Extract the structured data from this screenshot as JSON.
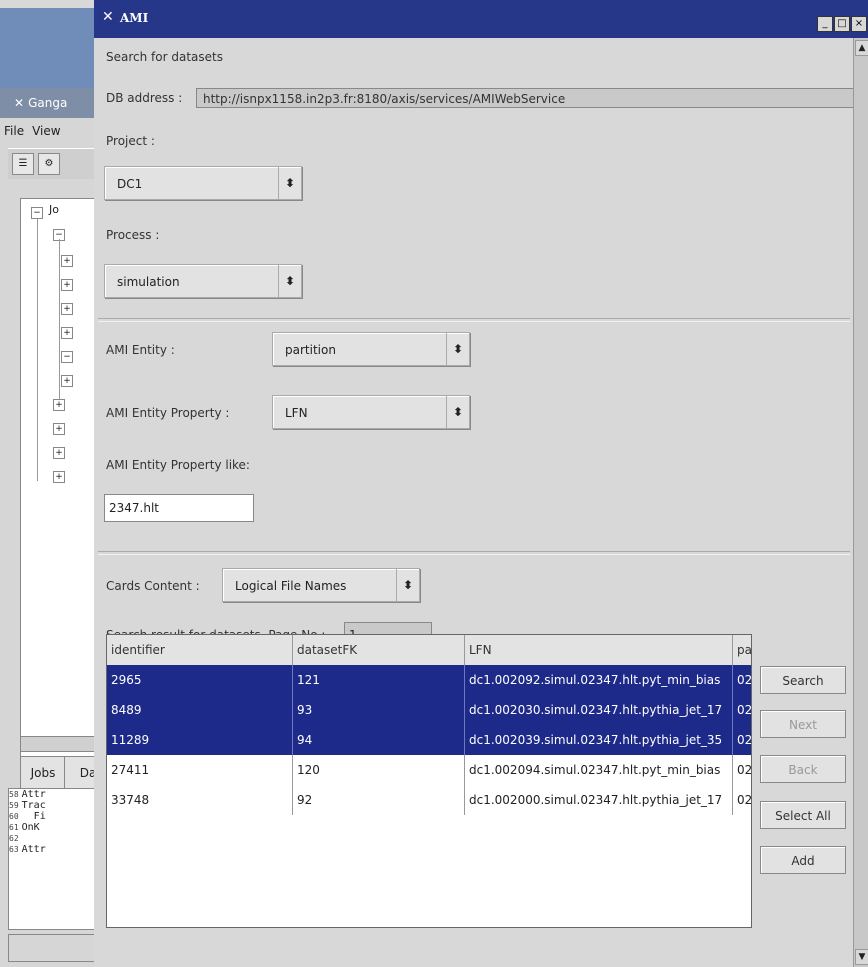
{
  "background_window": {
    "title": "Ganga",
    "menu": [
      "File",
      "View"
    ],
    "tree_label": "Jo",
    "tabs": [
      "Jobs",
      "Da"
    ],
    "console_lines": [
      {
        "num": "58",
        "text": "Attr"
      },
      {
        "num": "59",
        "text": "Trac"
      },
      {
        "num": "60",
        "text": "  Fi"
      },
      {
        "num": "61",
        "text": "OnK"
      },
      {
        "num": "62",
        "text": ""
      },
      {
        "num": "63",
        "text": "Attr"
      }
    ]
  },
  "dialog": {
    "title": "AMI",
    "window_buttons": [
      "_",
      "□",
      "×"
    ],
    "heading": "Search for datasets",
    "db_address_label": "DB address :",
    "db_address_value": "http://isnpx1158.in2p3.fr:8180/axis/services/AMIWebService",
    "project_label": "Project :",
    "project_value": "DC1",
    "process_label": "Process :",
    "process_value": "simulation",
    "entity_label": "AMI Entity :",
    "entity_value": "partition",
    "entity_property_label": "AMI Entity Property :",
    "entity_property_value": "LFN",
    "property_like_label": "AMI Entity Property like:",
    "property_like_value": "2347.hlt",
    "cards_content_label": "Cards Content :",
    "cards_content_value": "Logical File Names",
    "page_label": "Search result for datasets. Page No :",
    "page_value": "1",
    "table": {
      "columns": [
        "identifier",
        "datasetFK",
        "LFN",
        "pa"
      ],
      "rows": [
        {
          "identifier": "2965",
          "datasetFK": "121",
          "lfn": "dc1.002092.simul.02347.hlt.pyt_min_bias",
          "pa": "02",
          "selected": true
        },
        {
          "identifier": "8489",
          "datasetFK": "93",
          "lfn": "dc1.002030.simul.02347.hlt.pythia_jet_17",
          "pa": "02",
          "selected": true
        },
        {
          "identifier": "11289",
          "datasetFK": "94",
          "lfn": "dc1.002039.simul.02347.hlt.pythia_jet_35",
          "pa": "02",
          "selected": true
        },
        {
          "identifier": "27411",
          "datasetFK": "120",
          "lfn": "dc1.002094.simul.02347.hlt.pyt_min_bias",
          "pa": "02",
          "selected": false
        },
        {
          "identifier": "33748",
          "datasetFK": "92",
          "lfn": "dc1.002000.simul.02347.hlt.pythia_jet_17",
          "pa": "02",
          "selected": false
        }
      ]
    },
    "buttons": {
      "search": "Search",
      "next": "Next",
      "back": "Back",
      "select_all": "Select All",
      "add": "Add"
    }
  },
  "colors": {
    "selection": "#1e2a8a",
    "titlebar": "#26378a"
  }
}
